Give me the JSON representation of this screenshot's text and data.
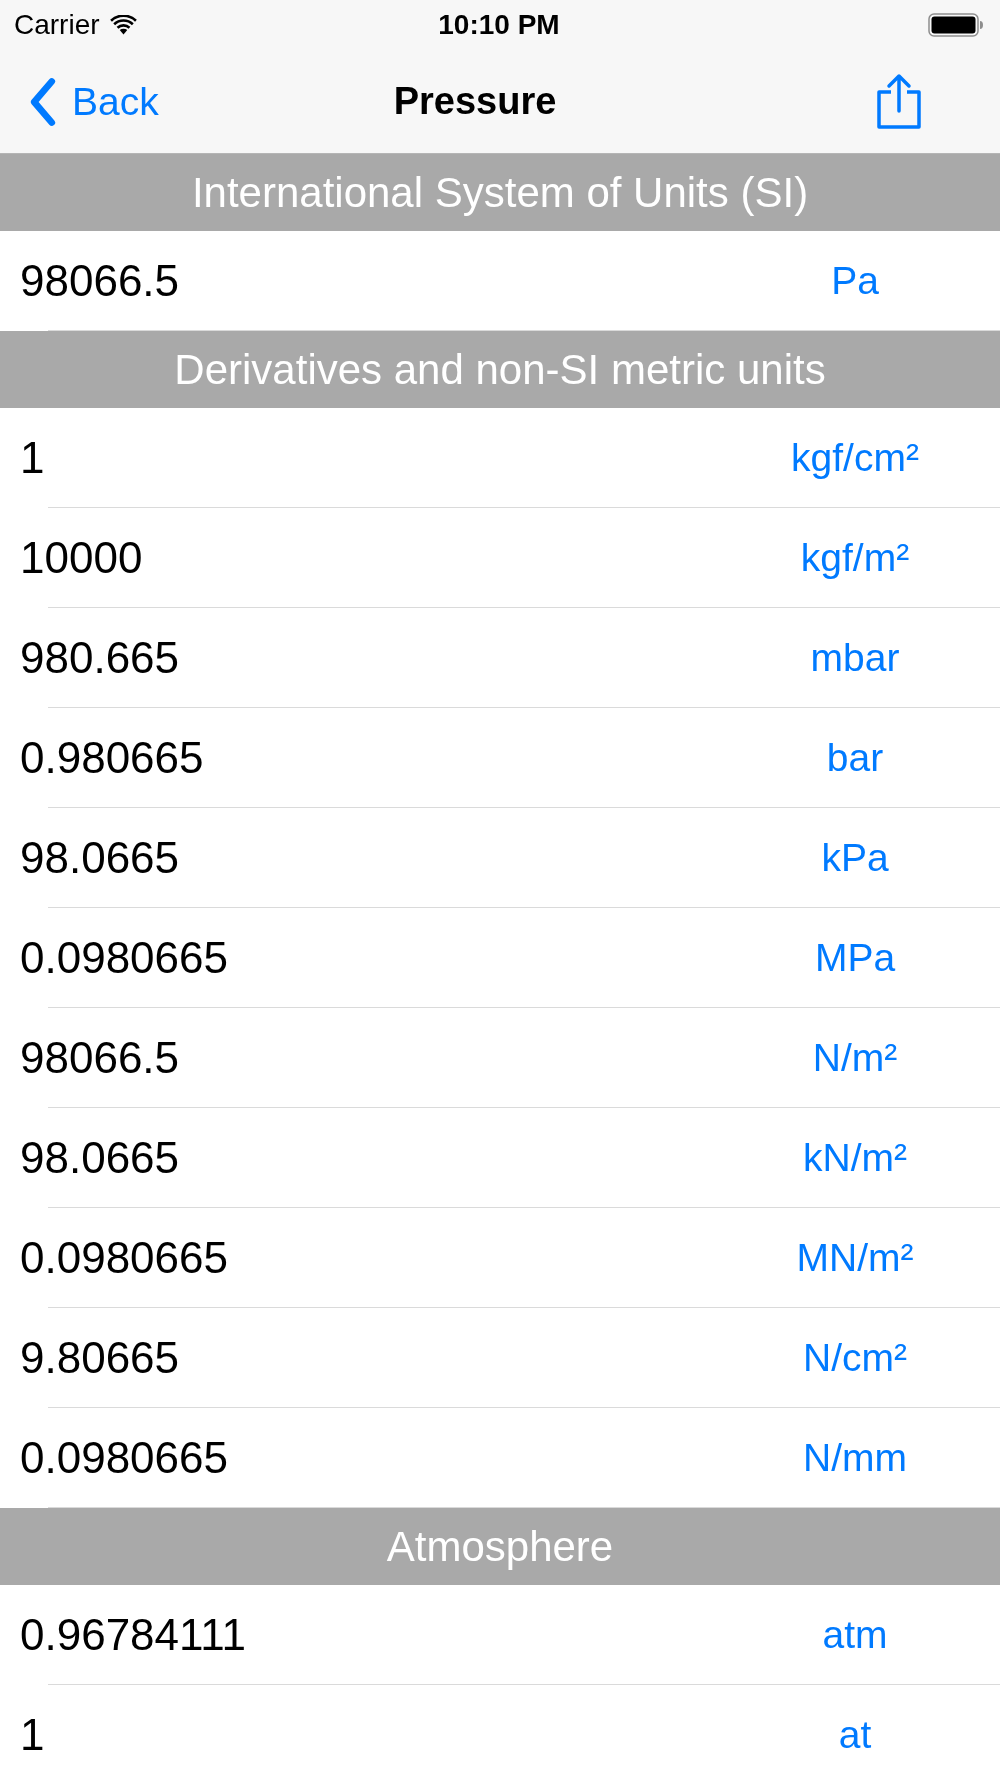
{
  "status_bar": {
    "carrier": "Carrier",
    "time": "10:10 PM"
  },
  "nav_bar": {
    "back": "Back",
    "title": "Pressure"
  },
  "sections": [
    {
      "title": "International System of Units (SI)",
      "rows": [
        {
          "value": "98066.5",
          "unit": "Pa"
        }
      ]
    },
    {
      "title": "Derivatives and non-SI metric units",
      "rows": [
        {
          "value": "1",
          "unit": "kgf/cm²"
        },
        {
          "value": "10000",
          "unit": "kgf/m²"
        },
        {
          "value": "980.665",
          "unit": "mbar"
        },
        {
          "value": "0.980665",
          "unit": "bar"
        },
        {
          "value": "98.0665",
          "unit": "kPa"
        },
        {
          "value": "0.0980665",
          "unit": "MPa"
        },
        {
          "value": "98066.5",
          "unit": "N/m²"
        },
        {
          "value": "98.0665",
          "unit": "kN/m²"
        },
        {
          "value": "0.0980665",
          "unit": "MN/m²"
        },
        {
          "value": "9.80665",
          "unit": "N/cm²"
        },
        {
          "value": "0.0980665",
          "unit": "N/mm"
        }
      ]
    },
    {
      "title": "Atmosphere",
      "rows": [
        {
          "value": "0.96784111",
          "unit": "atm"
        },
        {
          "value": "1",
          "unit": "at"
        }
      ]
    }
  ]
}
